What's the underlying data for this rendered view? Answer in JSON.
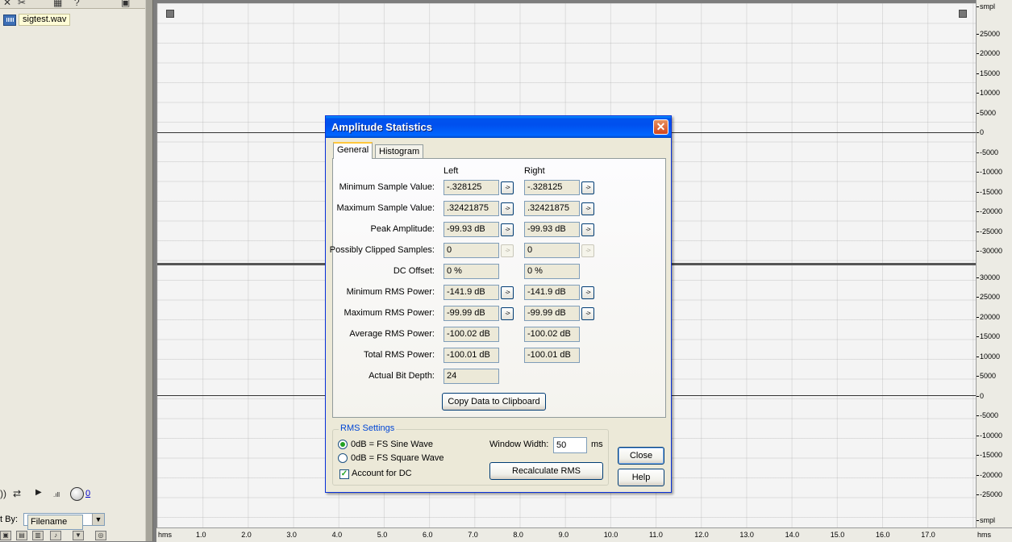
{
  "left_panel": {
    "file_name": "sigtest.wav",
    "volume_value": "0",
    "sort_label": "t By:",
    "sort_value": "Filename"
  },
  "y_axis": {
    "unit_top": "smpl",
    "unit_bottom": "smpl",
    "ticks_top": [
      "25000",
      "20000",
      "15000",
      "10000",
      "5000",
      "0",
      "-5000",
      "-10000",
      "-15000",
      "-20000",
      "-25000",
      "-30000"
    ],
    "ticks_bottom": [
      "30000",
      "25000",
      "20000",
      "15000",
      "10000",
      "5000",
      "0",
      "-5000",
      "-10000",
      "-15000",
      "-20000",
      "-25000"
    ]
  },
  "x_axis": {
    "unit_left": "hms",
    "unit_right": "hms",
    "ticks": [
      "1.0",
      "2.0",
      "3.0",
      "4.0",
      "5.0",
      "6.0",
      "7.0",
      "8.0",
      "9.0",
      "10.0",
      "11.0",
      "12.0",
      "13.0",
      "14.0",
      "15.0",
      "16.0",
      "17.0"
    ]
  },
  "dialog": {
    "title": "Amplitude Statistics",
    "tabs": [
      "General",
      "Histogram"
    ],
    "columns": {
      "left": "Left",
      "right": "Right"
    },
    "rows": [
      {
        "label": "Minimum Sample Value:",
        "left": "-.328125",
        "right": "-.328125",
        "button": "->"
      },
      {
        "label": "Maximum Sample Value:",
        "left": ".32421875",
        "right": ".32421875",
        "button": "->"
      },
      {
        "label": "Peak Amplitude:",
        "left": "-99.93 dB",
        "right": "-99.93 dB",
        "button": "->"
      },
      {
        "label": "Possibly Clipped Samples:",
        "left": "0",
        "right": "0",
        "button": "->"
      },
      {
        "label": "DC Offset:",
        "left": "0 %",
        "right": "0 %"
      },
      {
        "label": "Minimum RMS Power:",
        "left": "-141.9 dB",
        "right": "-141.9 dB",
        "button": "->"
      },
      {
        "label": "Maximum RMS Power:",
        "left": "-99.99 dB",
        "right": "-99.99 dB",
        "button": "->"
      },
      {
        "label": "Average RMS Power:",
        "left": "-100.02 dB",
        "right": "-100.02 dB"
      },
      {
        "label": "Total RMS Power:",
        "left": "-100.01 dB",
        "right": "-100.01 dB"
      },
      {
        "label": "Actual Bit Depth:",
        "left": "24"
      }
    ],
    "copy_button": "Copy Data to Clipboard",
    "rms_settings": {
      "legend": "RMS Settings",
      "option_sine": "0dB = FS Sine Wave",
      "option_square": "0dB = FS Square Wave",
      "selected": "sine",
      "account_dc_label": "Account for DC",
      "account_dc_checked": true,
      "window_width_label": "Window Width:",
      "window_width_value": "50",
      "window_width_unit": "ms",
      "recalc_button": "Recalculate RMS"
    },
    "close_button": "Close",
    "help_button": "Help"
  }
}
